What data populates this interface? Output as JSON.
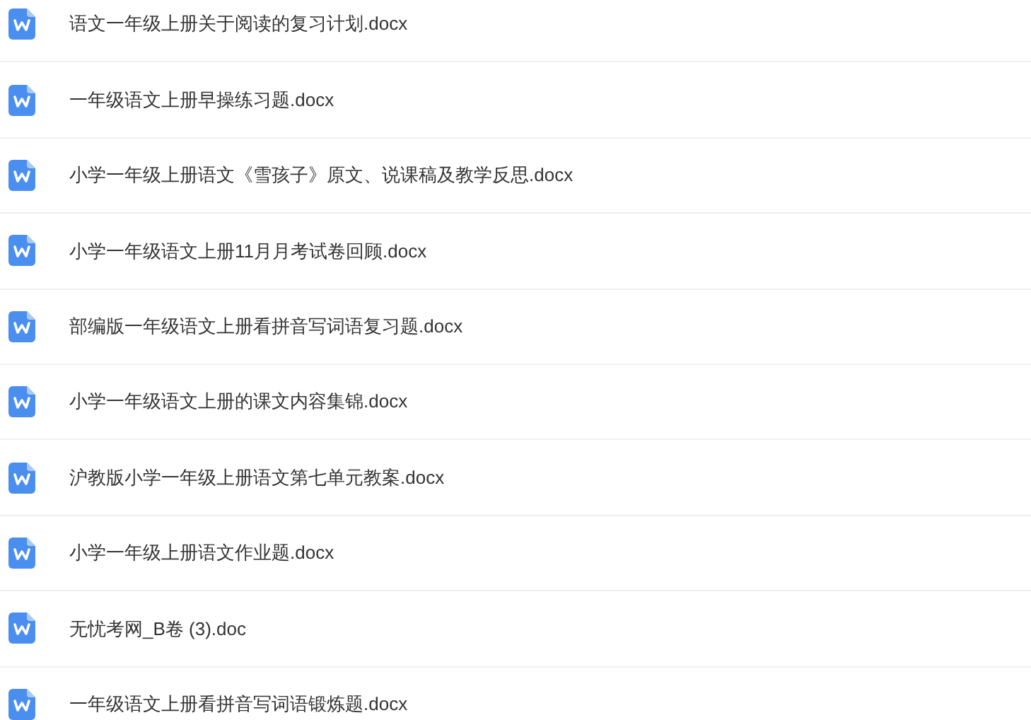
{
  "files": [
    {
      "name": "语文一年级上册关于阅读的复习计划.docx"
    },
    {
      "name": "一年级语文上册早操练习题.docx"
    },
    {
      "name": "小学一年级上册语文《雪孩子》原文、说课稿及教学反思.docx"
    },
    {
      "name": "小学一年级语文上册11月月考试卷回顾.docx"
    },
    {
      "name": "部编版一年级语文上册看拼音写词语复习题.docx"
    },
    {
      "name": "小学一年级语文上册的课文内容集锦.docx"
    },
    {
      "name": "沪教版小学一年级上册语文第七单元教案.docx"
    },
    {
      "name": "小学一年级上册语文作业题.docx"
    },
    {
      "name": "无忧考网_B卷 (3).doc"
    },
    {
      "name": "一年级语文上册看拼音写词语锻炼题.docx"
    }
  ]
}
